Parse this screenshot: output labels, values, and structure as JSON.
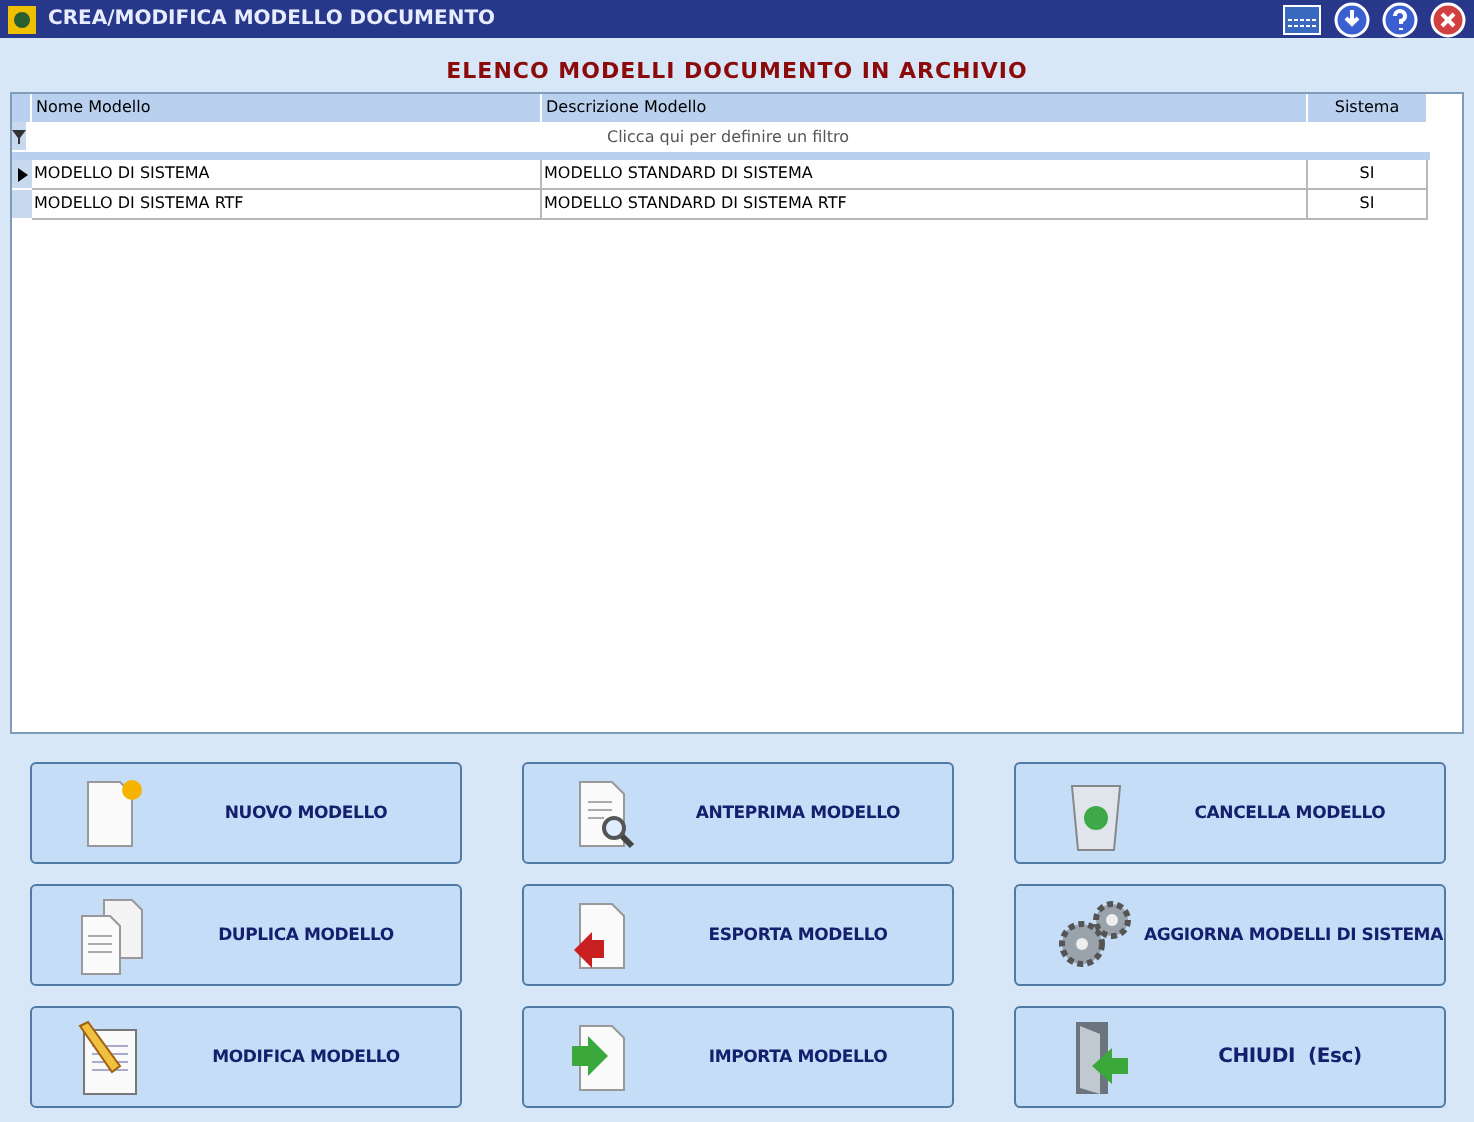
{
  "window": {
    "title": "CREA/MODIFICA MODELLO DOCUMENTO"
  },
  "heading": "ELENCO MODELLI DOCUMENTO IN ARCHIVIO",
  "table": {
    "columns": [
      "Nome Modello",
      "Descrizione Modello",
      "Sistema"
    ],
    "filter_hint": "Clicca qui per definire un filtro",
    "rows": [
      {
        "cells": [
          "MODELLO DI SISTEMA",
          "MODELLO STANDARD DI SISTEMA",
          "SI"
        ],
        "selected": true
      },
      {
        "cells": [
          "MODELLO DI SISTEMA RTF",
          "MODELLO STANDARD DI SISTEMA RTF",
          "SI"
        ],
        "selected": false
      }
    ]
  },
  "buttons": [
    {
      "label": "NUOVO MODELLO",
      "kind": "new"
    },
    {
      "label": "ANTEPRIMA MODELLO",
      "kind": "preview"
    },
    {
      "label": "CANCELLA MODELLO",
      "kind": "delete"
    },
    {
      "label": "DUPLICA MODELLO",
      "kind": "duplicate"
    },
    {
      "label": "ESPORTA MODELLO",
      "kind": "export"
    },
    {
      "label": "AGGIORNA MODELLI DI SISTEMA",
      "kind": "update"
    },
    {
      "label": "MODIFICA MODELLO",
      "kind": "edit"
    },
    {
      "label": "IMPORTA MODELLO",
      "kind": "import"
    },
    {
      "label": "CHIUDI  (Esc)",
      "kind": "close"
    }
  ]
}
